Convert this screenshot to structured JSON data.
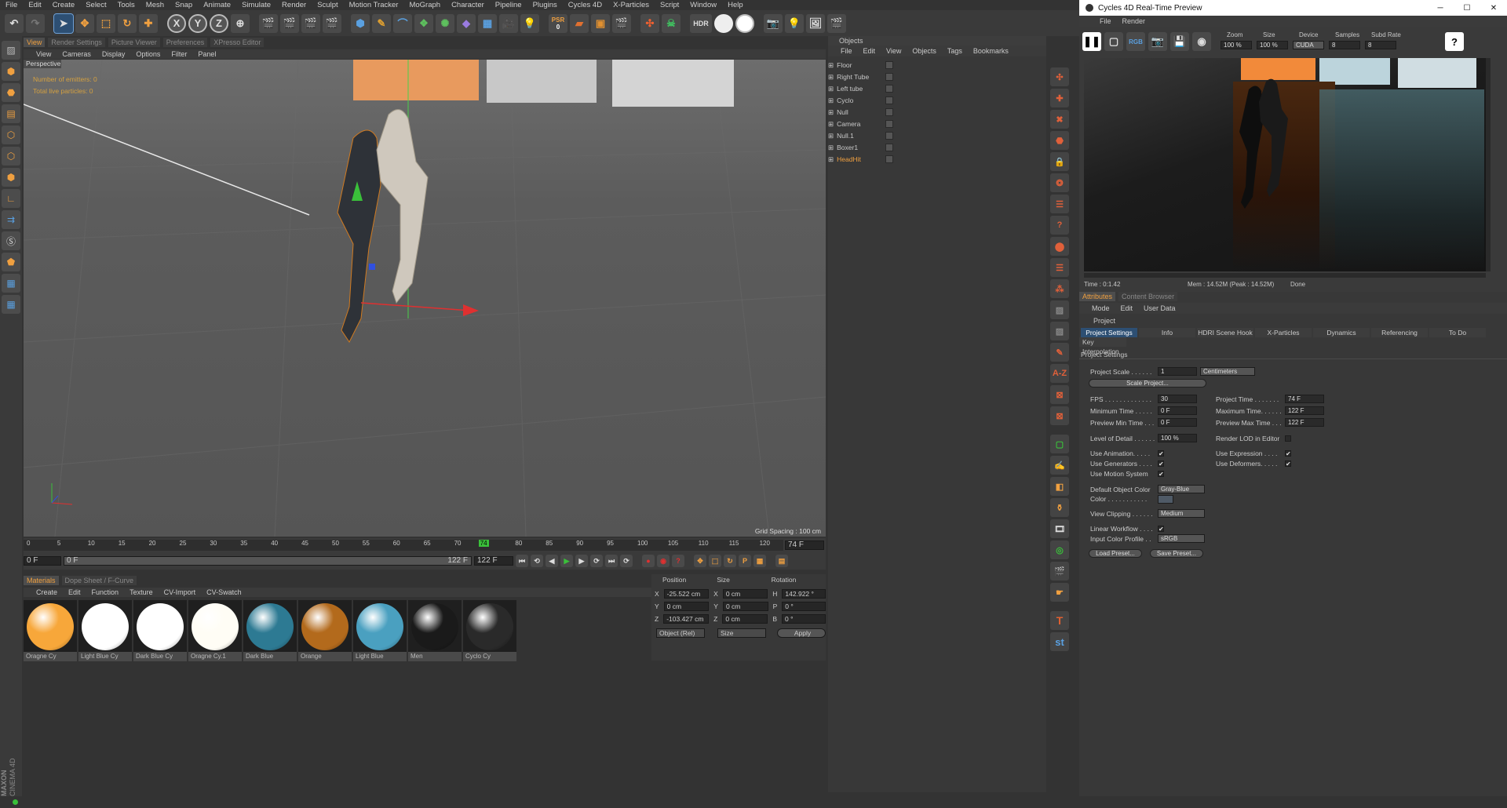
{
  "menubar": [
    "File",
    "Edit",
    "Create",
    "Select",
    "Tools",
    "Mesh",
    "Snap",
    "Animate",
    "Simulate",
    "Render",
    "Sculpt",
    "Motion Tracker",
    "MoGraph",
    "Character",
    "Pipeline",
    "Plugins",
    "Cycles 4D",
    "X-Particles",
    "Script",
    "Window",
    "Help"
  ],
  "toolbar": {
    "x": "X",
    "y": "Y",
    "z": "Z",
    "psr": "PSR",
    "psr_count": "0",
    "hdr": "HDR"
  },
  "viewport_tabs": [
    "View",
    "Render Settings",
    "Picture Viewer",
    "Preferences",
    "XPresso Editor"
  ],
  "viewport_menu": [
    "View",
    "Cameras",
    "Display",
    "Options",
    "Filter",
    "Panel"
  ],
  "viewport": {
    "name": "Perspective",
    "hud1": "Number of emitters: 0",
    "hud2": "Total live particles: 0",
    "grid_spacing": "Grid Spacing : 100 cm"
  },
  "timeline": {
    "ticks": [
      "0",
      "5",
      "10",
      "15",
      "20",
      "25",
      "30",
      "35",
      "40",
      "45",
      "50",
      "55",
      "60",
      "65",
      "70",
      "74",
      "80",
      "85",
      "90",
      "95",
      "100",
      "105",
      "110",
      "115",
      "120"
    ],
    "current_frame": "74 F",
    "start": "0 F",
    "start2": "0 F",
    "end": "122 F",
    "end2": "122 F"
  },
  "materials_tabs": [
    "Materials",
    "Dope Sheet / F-Curve"
  ],
  "materials_menu": [
    "Create",
    "Edit",
    "Function",
    "Texture",
    "CV-Import",
    "CV-Swatch"
  ],
  "materials": [
    {
      "name": "Oragne Cy",
      "color": "#f7a73a"
    },
    {
      "name": "Light Blue Cy",
      "color": "#ffffff"
    },
    {
      "name": "Dark Blue Cy",
      "color": "#ffffff"
    },
    {
      "name": "Oragne Cy.1",
      "color": "#fffdf5"
    },
    {
      "name": "Dark Blue",
      "color": "#2d7a93"
    },
    {
      "name": "Orange",
      "color": "#b36a1c"
    },
    {
      "name": "Light Blue",
      "color": "#4aa0c0"
    },
    {
      "name": "Men",
      "color": "#1a1a1a"
    },
    {
      "name": "Cyclo Cy",
      "color": "#2a2a2a"
    }
  ],
  "coords": {
    "headers": [
      "Position",
      "Size",
      "Rotation"
    ],
    "rows": [
      {
        "axis": "X",
        "pos": "-25.522 cm",
        "size": "0 cm",
        "rlabel": "H",
        "rot": "142.922 °"
      },
      {
        "axis": "Y",
        "pos": "0 cm",
        "size": "0 cm",
        "rlabel": "P",
        "rot": "0 °"
      },
      {
        "axis": "Z",
        "pos": "-103.427 cm",
        "size": "0 cm",
        "rlabel": "B",
        "rot": "0 °"
      }
    ],
    "mode": "Object (Rel)",
    "size_mode": "Size",
    "apply": "Apply"
  },
  "objects": {
    "title": "Objects",
    "menu": [
      "File",
      "Edit",
      "View",
      "Objects",
      "Tags",
      "Bookmarks"
    ],
    "items": [
      {
        "name": "Floor",
        "highlight": false
      },
      {
        "name": "Right Tube",
        "highlight": false
      },
      {
        "name": "Left tube",
        "highlight": false
      },
      {
        "name": "Cyclo",
        "highlight": false
      },
      {
        "name": "Null",
        "highlight": false
      },
      {
        "name": "Camera",
        "highlight": false
      },
      {
        "name": "Null.1",
        "highlight": false
      },
      {
        "name": "Boxer1",
        "highlight": false
      },
      {
        "name": "HeadHit",
        "highlight": true
      }
    ]
  },
  "preview": {
    "title": "Cycles 4D Real-Time Preview",
    "menu": [
      "File",
      "Render"
    ],
    "rgb": "RGB",
    "labels": {
      "zoom": "Zoom",
      "size": "Size",
      "device": "Device",
      "samples": "Samples",
      "subd": "Subd Rate"
    },
    "values": {
      "zoom": "100 %",
      "size": "100 %",
      "device": "CUDA",
      "samples": "8",
      "subd": "8"
    },
    "status": {
      "time": "Time : 0:1.42",
      "mem": "Mem : 14.52M (Peak : 14.52M)",
      "done": "Done"
    }
  },
  "attributes": {
    "tabs": [
      "Attributes",
      "Content Browser"
    ],
    "menu": [
      "Mode",
      "Edit",
      "User Data"
    ],
    "object": "Project",
    "subtabs": [
      "Project Settings",
      "Info",
      "HDRI Scene Hook",
      "X-Particles",
      "Dynamics",
      "Referencing",
      "To Do"
    ],
    "key_interp": "Key Interpolation",
    "section": "Project Settings",
    "project_scale_label": "Project Scale . . . . . .",
    "project_scale": "1",
    "unit": "Centimeters",
    "scale_btn": "Scale Project...",
    "fps_label": "FPS . . . . . . . . . . . . .",
    "fps": "30",
    "project_time_label": "Project Time . . . . . . .",
    "project_time": "74 F",
    "min_time_label": "Minimum Time . . . . .",
    "min_time": "0 F",
    "max_time_label": "Maximum Time. . . . . .",
    "max_time": "122 F",
    "prev_min_label": "Preview Min Time . . .",
    "prev_min": "0 F",
    "prev_max_label": "Preview Max Time . . .",
    "prev_max": "122 F",
    "lod_label": "Level of Detail . . . . . .",
    "lod": "100 %",
    "render_lod_label": "Render LOD in Editor",
    "use_anim": "Use Animation. . . . .",
    "use_gen": "Use Generators . . . .",
    "use_motion": "Use Motion System",
    "use_expr": "Use Expression . . . .",
    "use_def": "Use Deformers. . . . .",
    "doc_label": "Default Object Color",
    "doc": "Gray-Blue",
    "color_label": "Color . . . . . . . . . . .",
    "clip_label": "View Clipping . . . . . .",
    "clip": "Medium",
    "lw_label": "Linear Workflow . . . .",
    "icp_label": "Input Color Profile . .",
    "icp": "sRGB",
    "load_preset": "Load Preset...",
    "save_preset": "Save Preset...",
    "check": "✔"
  },
  "brand": {
    "l1": "MAXON",
    "l2": "CINEMA 4D"
  }
}
